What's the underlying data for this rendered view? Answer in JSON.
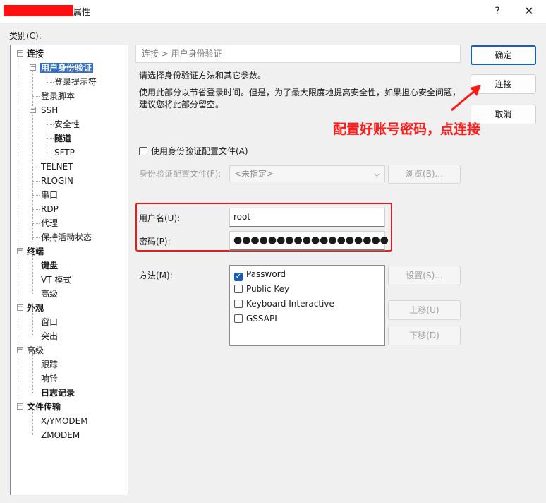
{
  "window": {
    "title_suffix": "属性",
    "help_glyph": "?",
    "close_glyph": "✕"
  },
  "category_label": "类别(C):",
  "tree": {
    "connection": "连接",
    "auth": "用户身份验证",
    "login_prompt": "登录提示符",
    "login_script": "登录脚本",
    "ssh": "SSH",
    "security": "安全性",
    "tunnel": "隧道",
    "sftp": "SFTP",
    "telnet": "TELNET",
    "rlogin": "RLOGIN",
    "serial": "串口",
    "rdp": "RDP",
    "proxy": "代理",
    "keepalive": "保持活动状态",
    "terminal": "终端",
    "keyboard": "键盘",
    "vt_mode": "VT 模式",
    "advanced_term": "高级",
    "appearance": "外观",
    "window": "窗口",
    "highlight": "突出",
    "advanced": "高级",
    "trace": "跟踪",
    "bell": "响铃",
    "logging": "日志记录",
    "file_transfer": "文件传输",
    "xymodem": "X/YMODEM",
    "zmodem": "ZMODEM"
  },
  "panel": {
    "breadcrumb": "连接 > 用户身份验证",
    "desc_line1": "请选择身份验证方法和其它参数。",
    "desc_line2": "使用此部分以节省登录时间。但是，为了最大限度地提高安全性，如果担心安全问题，",
    "desc_line3": "建议您将此部分留空。",
    "use_profile_label": "使用身份验证配置文件(A)",
    "profile_label": "身份验证配置文件(F):",
    "profile_value": "<未指定>",
    "browse_label": "浏览(B)...",
    "username_label": "用户名(U):",
    "username_value": "root",
    "password_label": "密码(P):",
    "password_value": "●●●●●●●●●●●●●●●●●●",
    "method_label": "方法(M):",
    "methods": [
      {
        "label": "Password",
        "checked": true
      },
      {
        "label": "Public Key",
        "checked": false
      },
      {
        "label": "Keyboard Interactive",
        "checked": false
      },
      {
        "label": "GSSAPI",
        "checked": false
      }
    ],
    "settings_label": "设置(S)...",
    "move_up_label": "上移(U)",
    "move_down_label": "下移(D)"
  },
  "buttons": {
    "ok": "确定",
    "connect": "连接",
    "cancel": "取消"
  },
  "annotation": {
    "text": "配置好账号密码，点连接",
    "color": "#ff1a1a"
  },
  "colors": {
    "accent": "#1a5fb4",
    "selection": "#2f6fc4",
    "highlight_box": "#e02020"
  }
}
